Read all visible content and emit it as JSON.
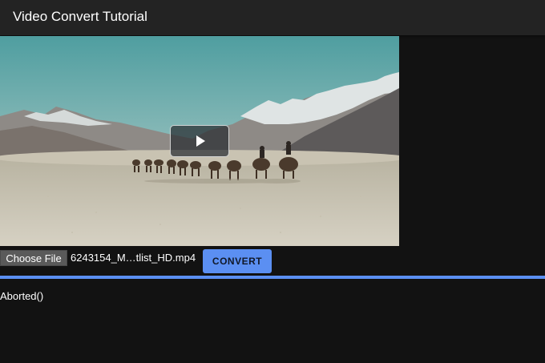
{
  "header": {
    "title": "Video Convert Tutorial"
  },
  "video": {
    "play_icon": "play-icon",
    "thumbnail": "desert camel caravan with mountains"
  },
  "file_input": {
    "button_label": "Choose File",
    "file_name": "6243154_M…tlist_HD.mp4"
  },
  "convert": {
    "label": "CONVERT"
  },
  "progress": {
    "value": 1.0
  },
  "log": {
    "message": "Aborted()"
  },
  "colors": {
    "accent": "#5b8ff2",
    "header_bg": "#232323",
    "page_bg": "#121212"
  }
}
